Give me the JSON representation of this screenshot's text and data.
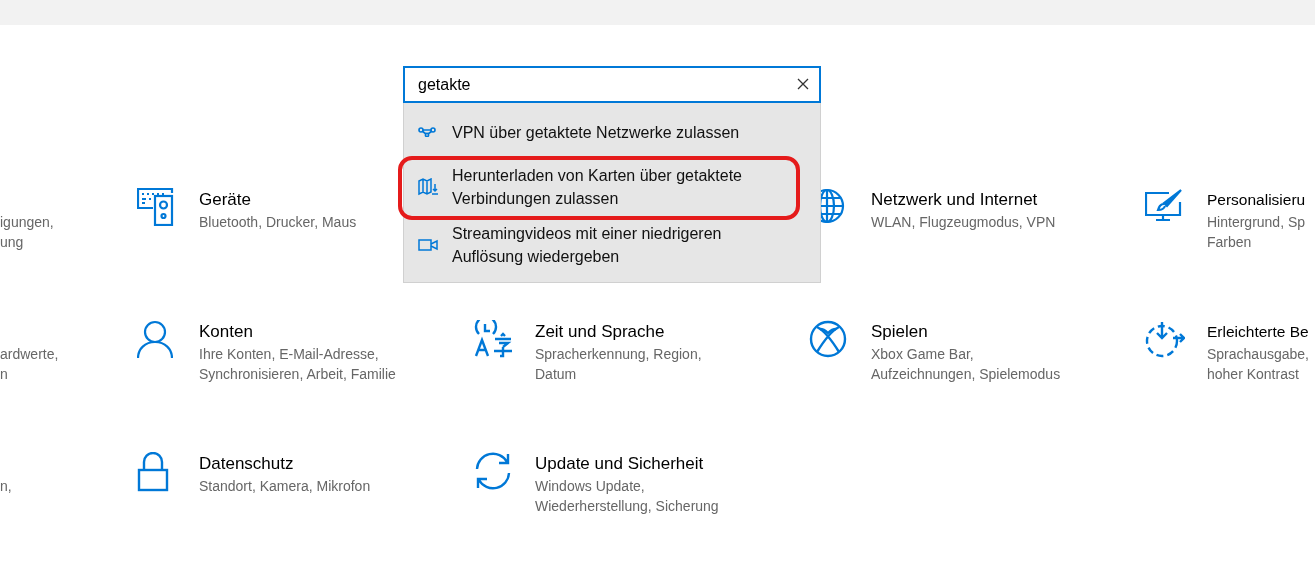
{
  "search": {
    "value": "getakte"
  },
  "results": [
    {
      "text": "VPN über getaktete Netzwerke zulassen",
      "highlighted": false
    },
    {
      "text": "Herunterladen von Karten über getaktete Verbindungen zulassen",
      "highlighted": true
    },
    {
      "text": "Streamingvideos mit einer niedrigeren Auflösung wiedergeben",
      "highlighted": false
    }
  ],
  "categories": [
    [
      {
        "description": "igungen, ung"
      },
      {
        "title": "Geräte",
        "description": "Bluetooth, Drucker, Maus"
      },
      {
        "title": "Netzwerk und Internet",
        "description": "WLAN, Flugzeugmodus, VPN"
      },
      {
        "title": "Personalisieru",
        "description": "Hintergrund, Sp Farben"
      }
    ],
    [
      {
        "description": "ardwerte, n"
      },
      {
        "title": "Konten",
        "description": "Ihre Konten, E-Mail-Adresse, Synchronisieren, Arbeit, Familie"
      },
      {
        "title": "Zeit und Sprache",
        "description": "Spracherkennung, Region, Datum"
      },
      {
        "title": "Spielen",
        "description": "Xbox Game Bar, Aufzeichnungen, Spielemodus"
      },
      {
        "title": "Erleichterte Be",
        "description": "Sprachausgabe, hoher Kontrast"
      }
    ],
    [
      {
        "description": "n,"
      },
      {
        "title": "Datenschutz",
        "description": "Standort, Kamera, Mikrofon"
      },
      {
        "title": "Update und Sicherheit",
        "description": "Windows Update, Wiederherstellung, Sicherung"
      }
    ]
  ]
}
